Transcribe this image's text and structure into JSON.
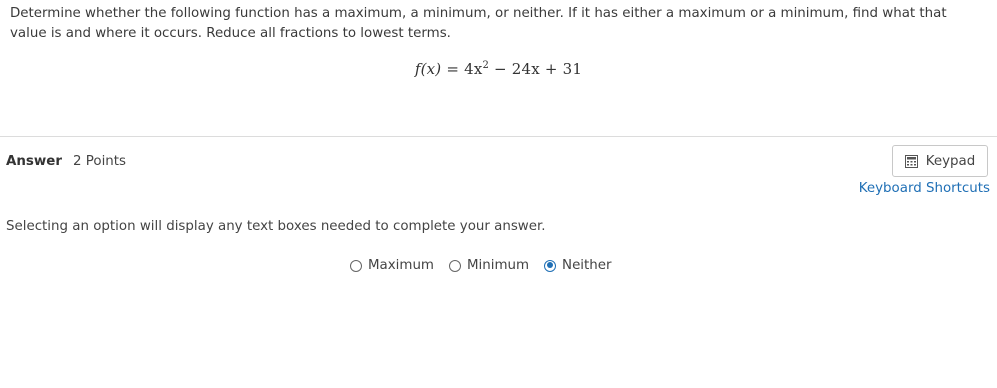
{
  "question": {
    "text": "Determine whether the following function has a maximum, a minimum, or neither. If it has either a maximum or a minimum, find what that value is and where it occurs. Reduce all fractions to lowest terms."
  },
  "formula": {
    "lhs": "f(x)",
    "eq": "=",
    "term1": "4x",
    "exp": "2",
    "op1": "−",
    "term2": "24x",
    "op2": "+",
    "term3": "31"
  },
  "answer": {
    "label": "Answer",
    "points": "2 Points"
  },
  "toolbar": {
    "keypad_label": "Keypad",
    "shortcuts_label": "Keyboard Shortcuts"
  },
  "instruction": "Selecting an option will display any text boxes needed to complete your answer.",
  "options": [
    {
      "label": "Maximum",
      "checked": false
    },
    {
      "label": "Minimum",
      "checked": false
    },
    {
      "label": "Neither",
      "checked": true
    }
  ],
  "colors": {
    "accent": "#1f6fb5",
    "divider": "#dcdcdc"
  },
  "icons": {
    "keypad": "calculator-icon"
  }
}
